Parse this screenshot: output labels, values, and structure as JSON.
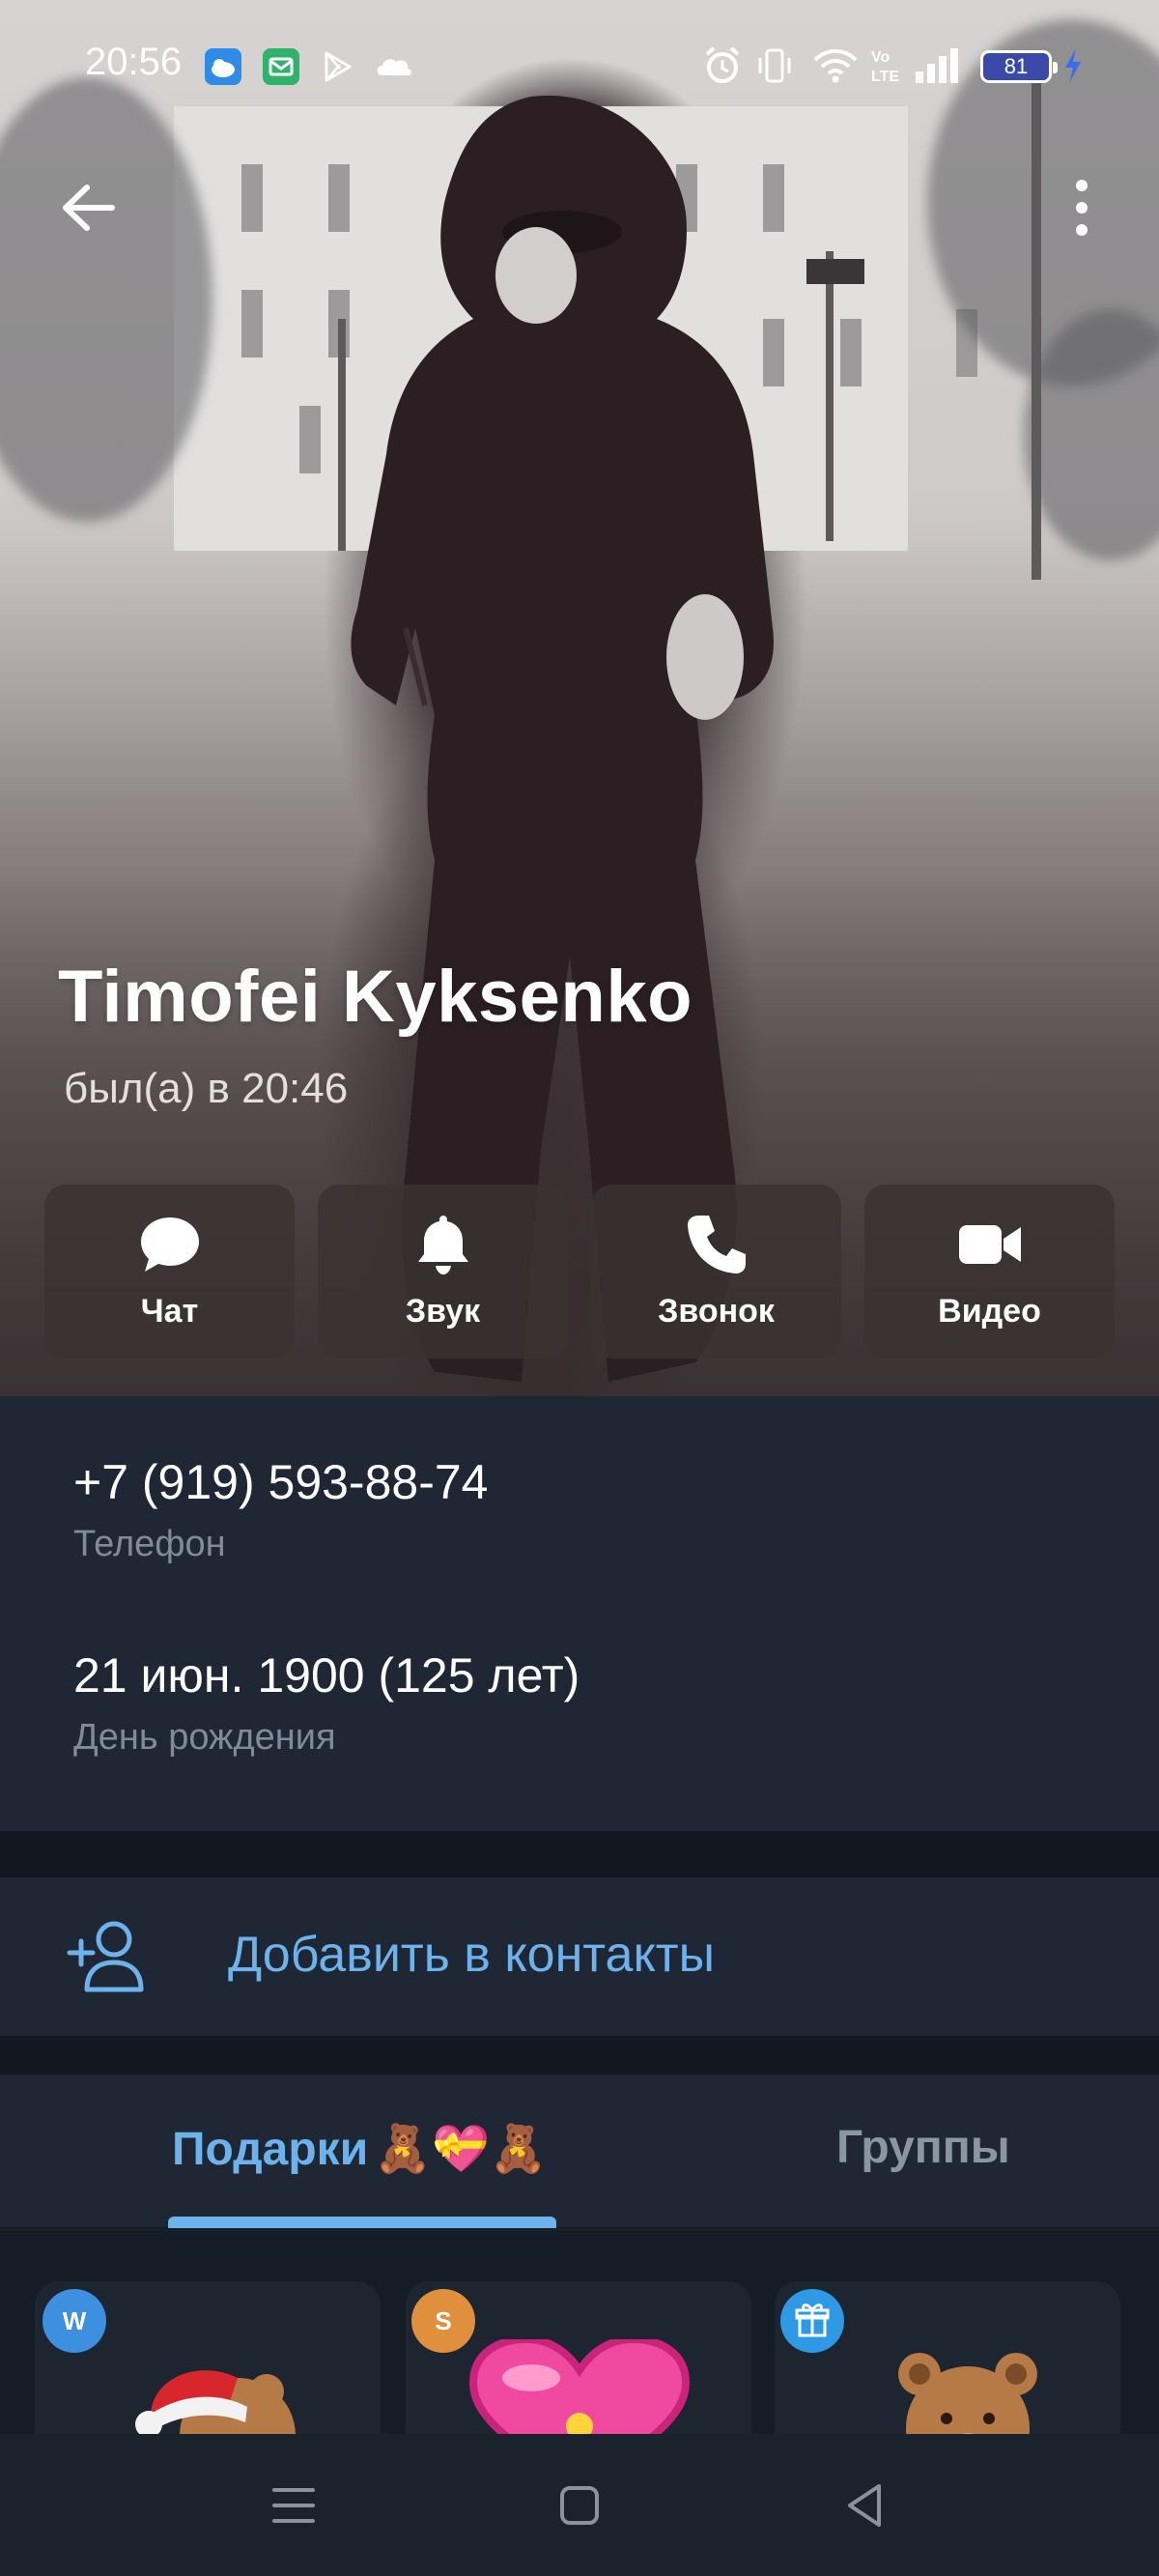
{
  "status_bar": {
    "time": "20:56",
    "battery": "81",
    "icons": [
      "weather-icon",
      "mail-icon",
      "play-store-icon",
      "cloud-icon",
      "alarm-icon",
      "vibrate-icon",
      "wifi-icon",
      "volte-icon",
      "signal-icon",
      "battery-icon",
      "charging-icon"
    ]
  },
  "header": {
    "back_icon": "arrow-left-icon",
    "menu_icon": "more-vertical-icon"
  },
  "profile": {
    "name": "Timofei Kyksenko",
    "status": "был(а) в 20:46"
  },
  "actions": [
    {
      "label": "Чат",
      "icon": "chat-icon"
    },
    {
      "label": "Звук",
      "icon": "bell-icon"
    },
    {
      "label": "Звонок",
      "icon": "phone-icon"
    },
    {
      "label": "Видео",
      "icon": "video-camera-icon"
    }
  ],
  "info": {
    "phone": {
      "value": "+7 (919) 593-88-74",
      "label": "Телефон"
    },
    "birthday": {
      "value": "21 июн. 1900 (125 лет)",
      "label": "День рождения"
    }
  },
  "add_contact": {
    "label": "Добавить в контакты",
    "icon": "add-user-icon"
  },
  "tabs": [
    {
      "label": "Подарки",
      "emoji": "🧸💝🧸",
      "active": true
    },
    {
      "label": "Группы",
      "active": false
    }
  ],
  "gifts": [
    {
      "badge": "W",
      "badge_color": "#3d8fe0",
      "item": "santa-teddy-bear"
    },
    {
      "badge": "S",
      "badge_color": "#e0903d",
      "item": "pink-heart"
    },
    {
      "badge": "",
      "badge_color": "#2e9ae6",
      "badge_icon": "gift-icon",
      "item": "teddy-bear"
    }
  ],
  "colors": {
    "accent": "#6cb2ec",
    "panel": "#1e2733",
    "separator": "#111820"
  }
}
